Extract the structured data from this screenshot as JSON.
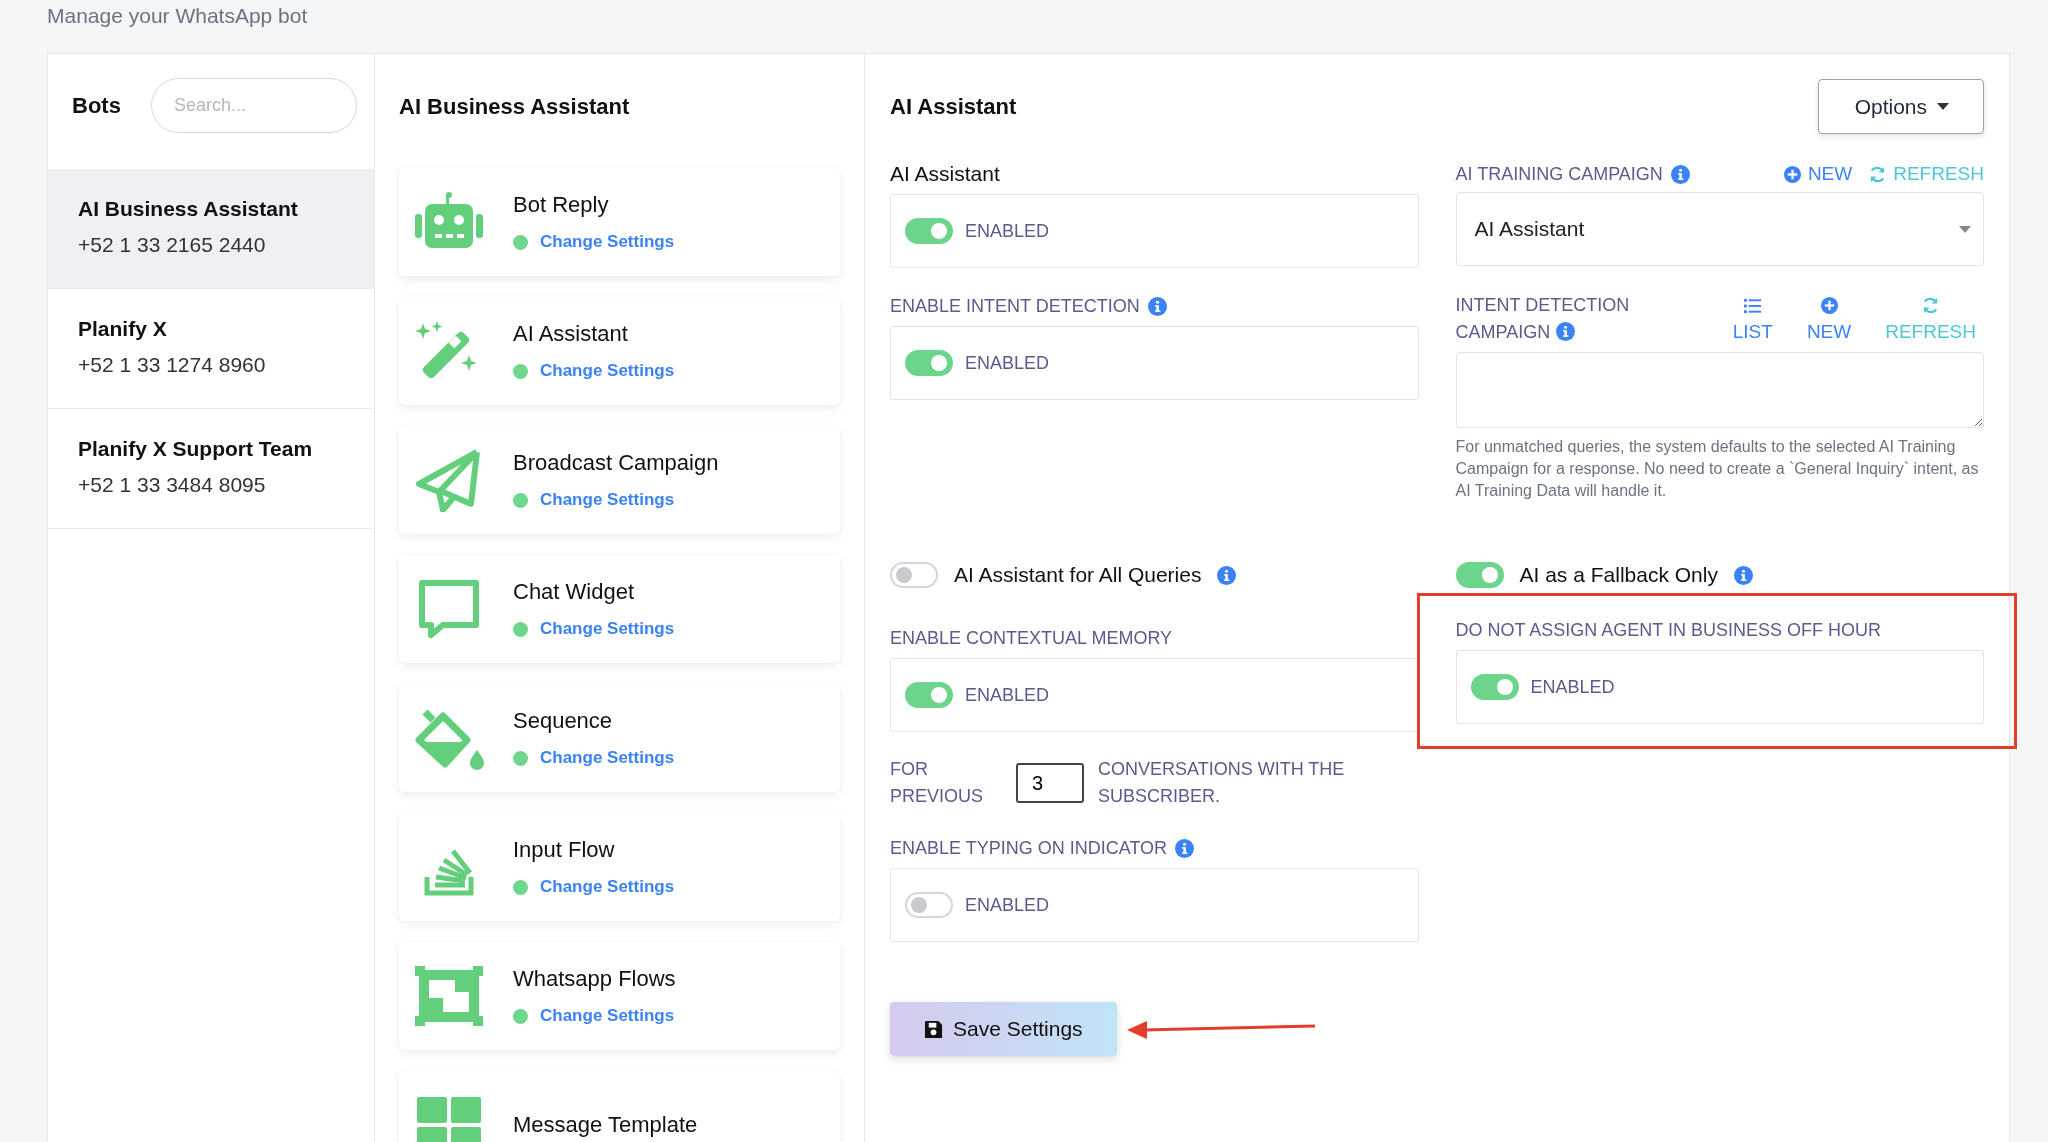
{
  "page_subtitle": "Manage your WhatsApp bot",
  "bots_panel": {
    "title": "Bots",
    "search": {
      "placeholder": "Search..."
    },
    "items": [
      {
        "name": "AI Business Assistant",
        "phone": "+52 1 33 2165 2440",
        "selected": true
      },
      {
        "name": "Planify X",
        "phone": "+52 1 33 1274 8960",
        "selected": false
      },
      {
        "name": "Planify X Support Team",
        "phone": "+52 1 33 3484 8095",
        "selected": false
      }
    ]
  },
  "features_panel": {
    "title": "AI Business Assistant",
    "items": [
      {
        "kind": "robot",
        "name": "Bot Reply",
        "link": "Change Settings"
      },
      {
        "kind": "wand",
        "name": "AI Assistant",
        "link": "Change Settings"
      },
      {
        "kind": "plane",
        "name": "Broadcast Campaign",
        "link": "Change Settings"
      },
      {
        "kind": "chat",
        "name": "Chat Widget",
        "link": "Change Settings"
      },
      {
        "kind": "bucket",
        "name": "Sequence",
        "link": "Change Settings"
      },
      {
        "kind": "stack",
        "name": "Input Flow",
        "link": "Change Settings"
      },
      {
        "kind": "flows",
        "name": "Whatsapp Flows",
        "link": "Change Settings"
      },
      {
        "kind": "grid",
        "name": "Message Template"
      }
    ]
  },
  "settings_panel": {
    "title": "AI Assistant",
    "options_button": "Options",
    "sections": [
      {
        "left": [
          {
            "kind": "title_switch_box",
            "label": "AI Assistant",
            "info": false,
            "on": true,
            "state_text": "ENABLED"
          },
          {
            "kind": "switch_box",
            "label": "ENABLE INTENT DETECTION",
            "info": true,
            "on": true,
            "state_text": "ENABLED"
          }
        ],
        "right": [
          {
            "kind": "select",
            "label": "AI TRAINING CAMPAIGN",
            "info": true,
            "actions": [
              {
                "kind": "new",
                "text": "NEW"
              },
              {
                "kind": "refresh",
                "text": "REFRESH"
              }
            ],
            "value": "AI Assistant"
          },
          {
            "kind": "textbox",
            "label": "INTENT DETECTION CAMPAIGN",
            "info": true,
            "actions": [
              {
                "kind": "list",
                "text": "LIST"
              },
              {
                "kind": "new",
                "text": "NEW"
              },
              {
                "kind": "refresh",
                "text": "REFRESH"
              }
            ],
            "help": "For unmatched queries, the system defaults to the selected AI Training Campaign for a response. No need to create a `General Inquiry` intent, as AI Training Data will handle it."
          }
        ]
      },
      {
        "left": [
          {
            "kind": "inline_switch",
            "label": "AI Assistant for All Queries",
            "info": true,
            "on": false
          }
        ],
        "right": [
          {
            "kind": "inline_switch",
            "label": "AI as a Fallback Only",
            "info": true,
            "on": true
          }
        ]
      },
      {
        "left": [
          {
            "kind": "switch_box",
            "label": "ENABLE CONTEXTUAL MEMORY",
            "info": false,
            "on": true,
            "state_text": "ENABLED"
          },
          {
            "kind": "count_row",
            "before": "FOR PREVIOUS",
            "value": "3",
            "after": "CONVERSATIONS WITH THE SUBSCRIBER."
          },
          {
            "kind": "switch_box",
            "label": "ENABLE TYPING ON INDICATOR",
            "info": true,
            "on": false,
            "state_text": "ENABLED"
          },
          {
            "kind": "button",
            "text": "Save Settings",
            "annotated": true
          }
        ],
        "right": [
          {
            "kind": "switch_box",
            "label": "DO NOT ASSIGN AGENT IN BUSINESS OFF HOUR",
            "info": false,
            "on": true,
            "state_text": "ENABLED",
            "highlighted": true
          }
        ]
      }
    ]
  }
}
